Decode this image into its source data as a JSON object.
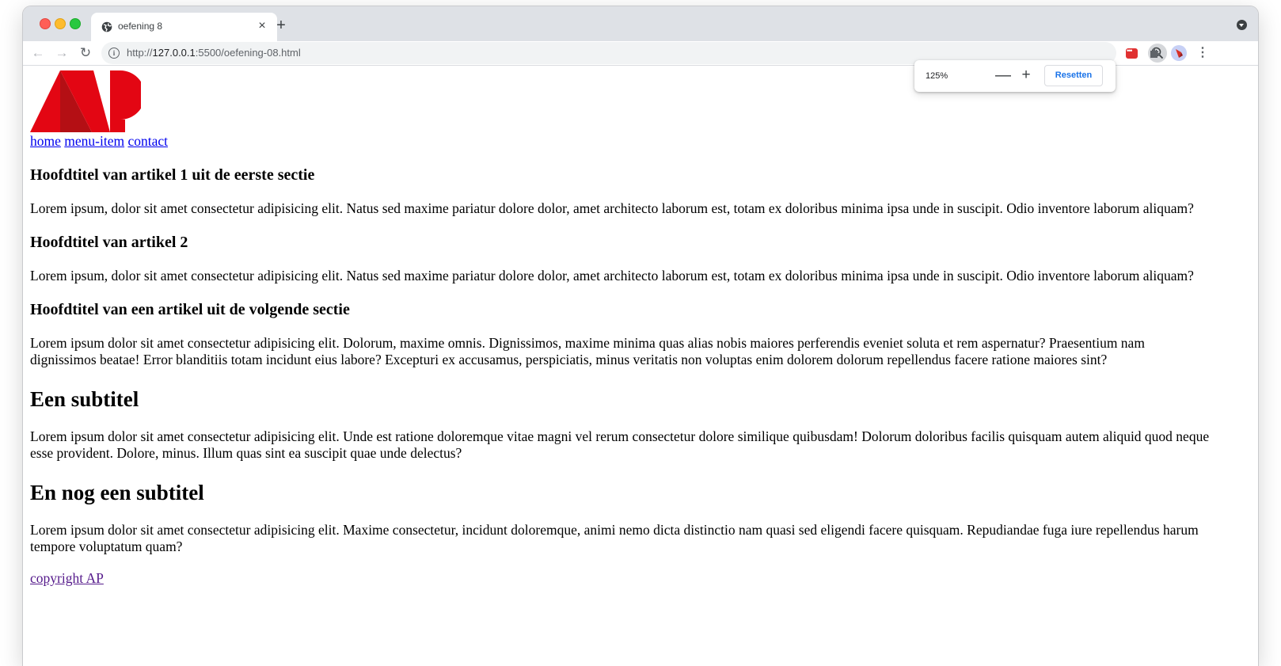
{
  "browser": {
    "tab": {
      "title": "oefening 8",
      "close_glyph": "×"
    },
    "new_tab_glyph": "+",
    "url_prefix": "http://",
    "url_host": "127.0.0.1",
    "url_rest": ":5500/oefening-08.html",
    "zoom_popup": {
      "percent": "125%",
      "minus_glyph": "—",
      "plus_glyph": "+",
      "reset_label": "Resetten"
    }
  },
  "page": {
    "nav": [
      "home",
      "menu-item",
      "contact"
    ],
    "articles": [
      {
        "heading": "Hoofdtitel van artikel 1 uit de eerste sectie",
        "text": "Lorem ipsum, dolor sit amet consectetur adipisicing elit. Natus sed maxime pariatur dolore dolor, amet architecto laborum est, totam ex doloribus minima ipsa unde in suscipit. Odio inventore laborum aliquam?"
      },
      {
        "heading": "Hoofdtitel van artikel 2",
        "text": "Lorem ipsum, dolor sit amet consectetur adipisicing elit. Natus sed maxime pariatur dolore dolor, amet architecto laborum est, totam ex doloribus minima ipsa unde in suscipit. Odio inventore laborum aliquam?"
      },
      {
        "heading": "Hoofdtitel van een artikel uit de volgende sectie",
        "text": "Lorem ipsum dolor sit amet consectetur adipisicing elit. Dolorum, maxime omnis. Dignissimos, maxime minima quas alias nobis maiores perferendis eveniet soluta et rem aspernatur? Praesentium nam dignissimos beatae! Error blanditiis totam incidunt eius labore? Excepturi ex accusamus, perspiciatis, minus veritatis non voluptas enim dolorem dolorum repellendus facere ratione maiores sint?"
      }
    ],
    "subtitles": [
      {
        "heading": "Een subtitel",
        "text": "Lorem ipsum dolor sit amet consectetur adipisicing elit. Unde est ratione doloremque vitae magni vel rerum consectetur dolore similique quibusdam! Dolorum doloribus facilis quisquam autem aliquid quod neque esse provident. Dolore, minus. Illum quas sint ea suscipit quae unde delectus?"
      },
      {
        "heading": "En nog een subtitel",
        "text": "Lorem ipsum dolor sit amet consectetur adipisicing elit. Maxime consectetur, incidunt doloremque, animi nemo dicta distinctio nam quasi sed eligendi facere quisquam. Repudiandae fuga iure repellendus harum tempore voluptatum quam?"
      }
    ],
    "footer_link": "copyright AP",
    "logo_text": "AP"
  },
  "colors": {
    "logo_red": "#e30613",
    "logo_dark_red": "#b40f14",
    "link": "#0000ee",
    "visited_link": "#551a8b",
    "accent_blue": "#1a73e8"
  }
}
